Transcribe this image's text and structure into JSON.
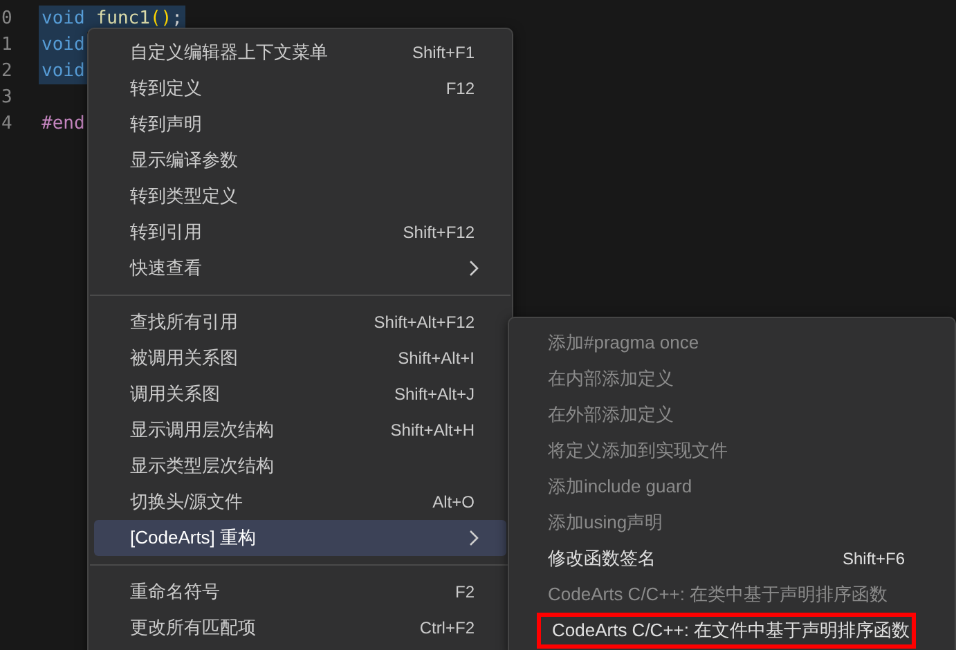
{
  "editor": {
    "lines": [
      {
        "number": "0",
        "tokens": [
          {
            "kind": "keyword",
            "text": "void"
          },
          {
            "kind": "function",
            "text": "func1"
          },
          {
            "kind": "paren",
            "text": "()"
          },
          {
            "kind": "plain",
            "text": ";"
          }
        ],
        "selected": true
      },
      {
        "number": "1",
        "tokens": [
          {
            "kind": "keyword",
            "text": "void"
          }
        ],
        "selected": true
      },
      {
        "number": "2",
        "tokens": [
          {
            "kind": "keyword",
            "text": "void"
          }
        ],
        "selected": true
      },
      {
        "number": "3"
      },
      {
        "number": "4",
        "tokens": [
          {
            "kind": "directive",
            "text": "#end"
          }
        ],
        "selected": false
      }
    ]
  },
  "context_menu": {
    "groups": [
      [
        {
          "label": "自定义编辑器上下文菜单",
          "shortcut": "Shift+F1",
          "submenu": false,
          "selected": false
        },
        {
          "label": "转到定义",
          "shortcut": "F12",
          "submenu": false,
          "selected": false
        },
        {
          "label": "转到声明",
          "submenu": false,
          "selected": false
        },
        {
          "label": "显示编译参数",
          "submenu": false,
          "selected": false
        },
        {
          "label": "转到类型定义",
          "submenu": false,
          "selected": false
        },
        {
          "label": "转到引用",
          "shortcut": "Shift+F12",
          "submenu": false,
          "selected": false
        },
        {
          "label": "快速查看",
          "submenu": true,
          "selected": false
        }
      ],
      [
        {
          "label": "查找所有引用",
          "shortcut": "Shift+Alt+F12",
          "submenu": false,
          "selected": false
        },
        {
          "label": "被调用关系图",
          "shortcut": "Shift+Alt+I",
          "submenu": false,
          "selected": false
        },
        {
          "label": "调用关系图",
          "shortcut": "Shift+Alt+J",
          "submenu": false,
          "selected": false
        },
        {
          "label": "显示调用层次结构",
          "shortcut": "Shift+Alt+H",
          "submenu": false,
          "selected": false
        },
        {
          "label": "显示类型层次结构",
          "submenu": false,
          "selected": false
        },
        {
          "label": "切换头/源文件",
          "shortcut": "Alt+O",
          "submenu": false,
          "selected": false
        },
        {
          "label": "[CodeArts] 重构",
          "submenu": true,
          "selected": true
        }
      ],
      [
        {
          "label": "重命名符号",
          "shortcut": "F2",
          "submenu": false,
          "selected": false
        },
        {
          "label": "更改所有匹配项",
          "shortcut": "Ctrl+F2",
          "submenu": false,
          "selected": false
        }
      ]
    ]
  },
  "submenu": {
    "items": [
      {
        "label": "添加#pragma once",
        "disabled": true,
        "highlighted": false
      },
      {
        "label": "在内部添加定义",
        "disabled": true,
        "highlighted": false
      },
      {
        "label": "在外部添加定义",
        "disabled": true,
        "highlighted": false
      },
      {
        "label": "将定义添加到实现文件",
        "disabled": true,
        "highlighted": false
      },
      {
        "label": "添加include guard",
        "disabled": true,
        "highlighted": false
      },
      {
        "label": "添加using声明",
        "disabled": true,
        "highlighted": false
      },
      {
        "label": "修改函数签名",
        "shortcut": "Shift+F6",
        "disabled": false,
        "highlighted": false
      },
      {
        "label": "CodeArts C/C++: 在类中基于声明排序函数",
        "disabled": true,
        "highlighted": false
      },
      {
        "label": "CodeArts C/C++: 在文件中基于声明排序函数",
        "disabled": false,
        "highlighted": true
      }
    ]
  }
}
